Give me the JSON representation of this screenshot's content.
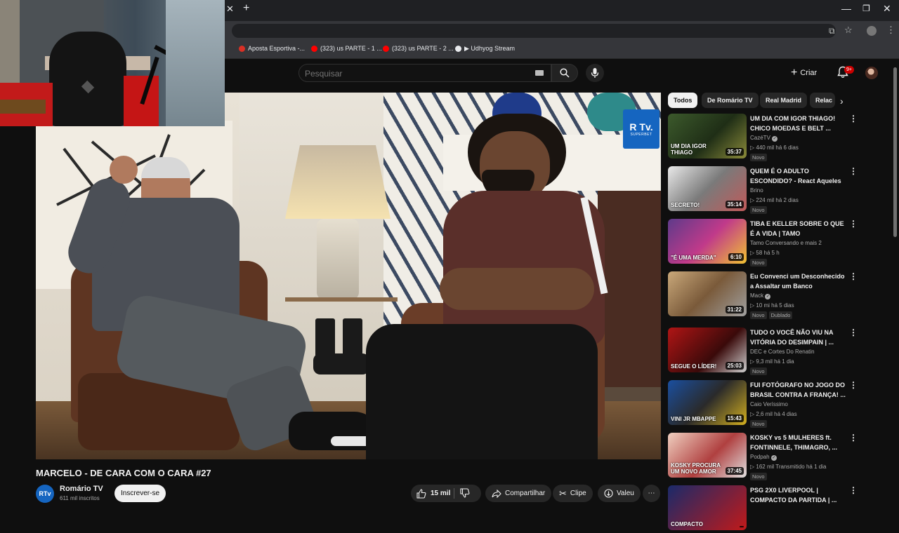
{
  "browser": {
    "bookmarks": [
      {
        "label": "Aposta Esportiva -...",
        "color": "#d93025"
      },
      {
        "label": "(323) us PARTE - 1 ...",
        "color": "#ff0000"
      },
      {
        "label": "(323) us PARTE - 2 ...",
        "color": "#ff0000"
      },
      {
        "label": "▶ Udhyog Stream",
        "color": "#e8eaed"
      }
    ]
  },
  "header": {
    "search_placeholder": "Pesquisar",
    "create_label": "Criar",
    "notifications_badge": "9+"
  },
  "player": {
    "watermark_logo": "R Tv.",
    "watermark_sub": "SUPERBET"
  },
  "video": {
    "title": "MARCELO - DE CARA COM O CARA #27",
    "channel_name": "Romário TV",
    "channel_initials": "RTv",
    "subscribers": "611 mil inscritos",
    "subscribe_label": "Inscrever-se",
    "likes": "15 mil",
    "share_label": "Compartilhar",
    "clip_label": "Clipe",
    "thanks_label": "Valeu"
  },
  "chips": [
    "Todos",
    "De Romário TV",
    "Real Madrid",
    "Relac"
  ],
  "recommendations": [
    {
      "title": "UM DIA COM IGOR THIAGO! CHICO MOEDAS E BELT ...",
      "channel": "CazéTV",
      "verified": true,
      "meta": "▷ 440 mil  há 6 dias",
      "badges": [
        "Novo"
      ],
      "duration": "35:37",
      "thumb_bg": "linear-gradient(135deg,#3c5a2c,#1f2e16 55%,#8b8b3a)",
      "thumb_text": "UM DIA IGOR THIAGO"
    },
    {
      "title": "QUEM É O ADULTO ESCONDIDO? - React Aqueles ...",
      "channel": "Brino",
      "verified": false,
      "meta": "▷ 224 mil  há 2 dias",
      "badges": [
        "Novo"
      ],
      "duration": "35:14",
      "thumb_bg": "linear-gradient(135deg,#e9e9e9,#7a7a7a 50%,#c05a5a)",
      "thumb_text": "SECRETO!"
    },
    {
      "title": "TIBA E KELLER SOBRE O QUE É A VIDA | TAMO CONVERSANDO",
      "channel": "Tamo Conversando e mais 2",
      "verified": false,
      "meta": "▷ 58  há 5 h",
      "badges": [
        "Novo"
      ],
      "duration": "6:10",
      "thumb_bg": "linear-gradient(135deg,#5e3a8a,#c03a8a 50%,#f1c232)",
      "thumb_text": "\"É UMA MERDA\""
    },
    {
      "title": "Eu Convenci um Desconhecido a Assaltar um Banco",
      "channel": "Mack",
      "verified": true,
      "meta": "▷ 10 mi  há 5 dias",
      "badges": [
        "Novo",
        "Dublado"
      ],
      "duration": "31:22",
      "thumb_bg": "linear-gradient(135deg,#c9a87a,#7a5a3a 50%,#a0a0a0)",
      "thumb_text": ""
    },
    {
      "title": "TUDO O VOCÊ NÃO VIU NA VITÓRIA DO DESIMPAIN | ...",
      "channel": "DEC e Cortes Do Renatin",
      "verified": false,
      "meta": "▷ 9,3 mil  há 1 dia",
      "badges": [
        "Novo"
      ],
      "duration": "25:03",
      "thumb_bg": "linear-gradient(135deg,#b01515,#3a0a0a 60%,#d0d0d0)",
      "thumb_text": "SEGUE O LÍDER!"
    },
    {
      "title": "FUI FOTÓGRAFO NO JOGO DO BRASIL CONTRA A FRANÇA! ...",
      "channel": "Caio Veríssimo",
      "verified": false,
      "meta": "▷ 2,6 mil  há 4 dias",
      "badges": [
        "Novo"
      ],
      "duration": "15:43",
      "thumb_bg": "linear-gradient(135deg,#1a4fa0,#2a2a2a 50%,#d4b020)",
      "thumb_text": "VINI JR  MBAPPE"
    },
    {
      "title": "KOSKY vs 5 MULHERES ft. FONTINNELE, THIMAGRO, ...",
      "channel": "Podpah",
      "verified": true,
      "meta": "▷ 162 mil  Transmitido há 1 dia",
      "badges": [
        "Novo"
      ],
      "duration": "37:45",
      "thumb_bg": "linear-gradient(135deg,#f0d0c0,#b04040 55%,#e0e0e0)",
      "thumb_text": "KOSKY PROCURA UM NOVO AMOR"
    },
    {
      "title": "PSG 2X0 LIVERPOOL | COMPACTO DA PARTIDA | ...",
      "channel": "",
      "verified": false,
      "meta": "",
      "badges": [],
      "duration": "",
      "thumb_bg": "linear-gradient(135deg,#1a2a6a,#c01a1a)",
      "thumb_text": "COMPACTO"
    }
  ]
}
